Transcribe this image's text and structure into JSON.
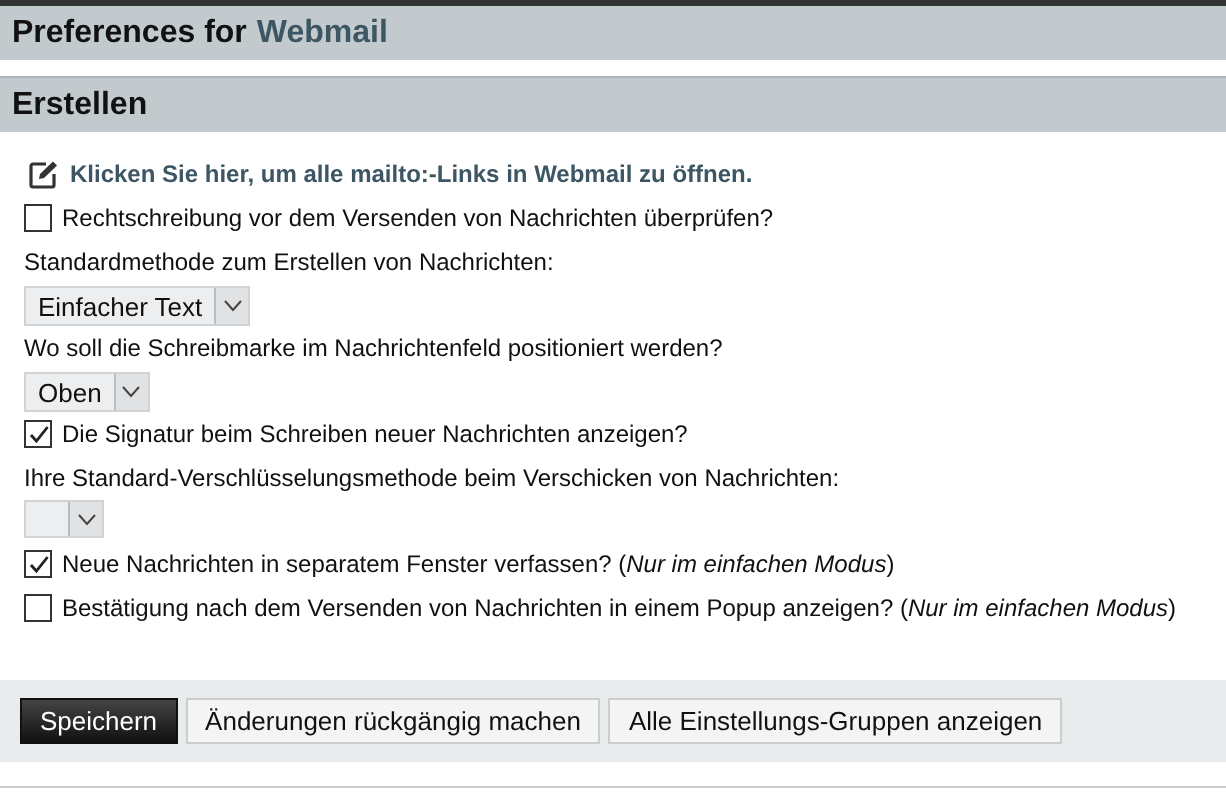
{
  "header": {
    "title": "Preferences for",
    "app_name": "Webmail"
  },
  "section": {
    "title": "Erstellen"
  },
  "items": [
    {
      "kind": "link",
      "text": "Klicken Sie hier, um alle mailto:-Links in Webmail zu öffnen."
    },
    {
      "kind": "checkbox",
      "text": "Rechtschreibung vor dem Versenden von Nachrichten überprüfen?",
      "checked": false
    },
    {
      "kind": "label",
      "text": "Standardmethode zum Erstellen von Nachrichten:"
    },
    {
      "kind": "select",
      "value": "Einfacher Text"
    },
    {
      "kind": "label",
      "text": "Wo soll die Schreibmarke im Nachrichtenfeld positioniert werden?"
    },
    {
      "kind": "select",
      "value": "Oben"
    },
    {
      "kind": "checkbox",
      "text": "Die Signatur beim Schreiben neuer Nachrichten anzeigen?",
      "checked": true
    },
    {
      "kind": "label",
      "text": "Ihre Standard-Verschlüsselungsmethode beim Verschicken von Nachrichten:"
    },
    {
      "kind": "select"
    },
    {
      "kind": "checkbox",
      "text": "Neue Nachrichten in separatem Fenster verfassen? (*Nur im einfachen Modus*)",
      "checked": true
    },
    {
      "kind": "checkbox",
      "text": "Bestätigung nach dem Versenden von Nachrichten in einem Popup anzeigen? (*Nur im einfachen Modus*)",
      "checked": false
    }
  ],
  "buttons": [
    {
      "kind": "primary",
      "label": "Speichern"
    },
    {
      "kind": "secondary",
      "label": "Änderungen rückgängig machen"
    },
    {
      "kind": "secondary",
      "label": "Alle Einstellungs-Gruppen anzeigen"
    }
  ]
}
